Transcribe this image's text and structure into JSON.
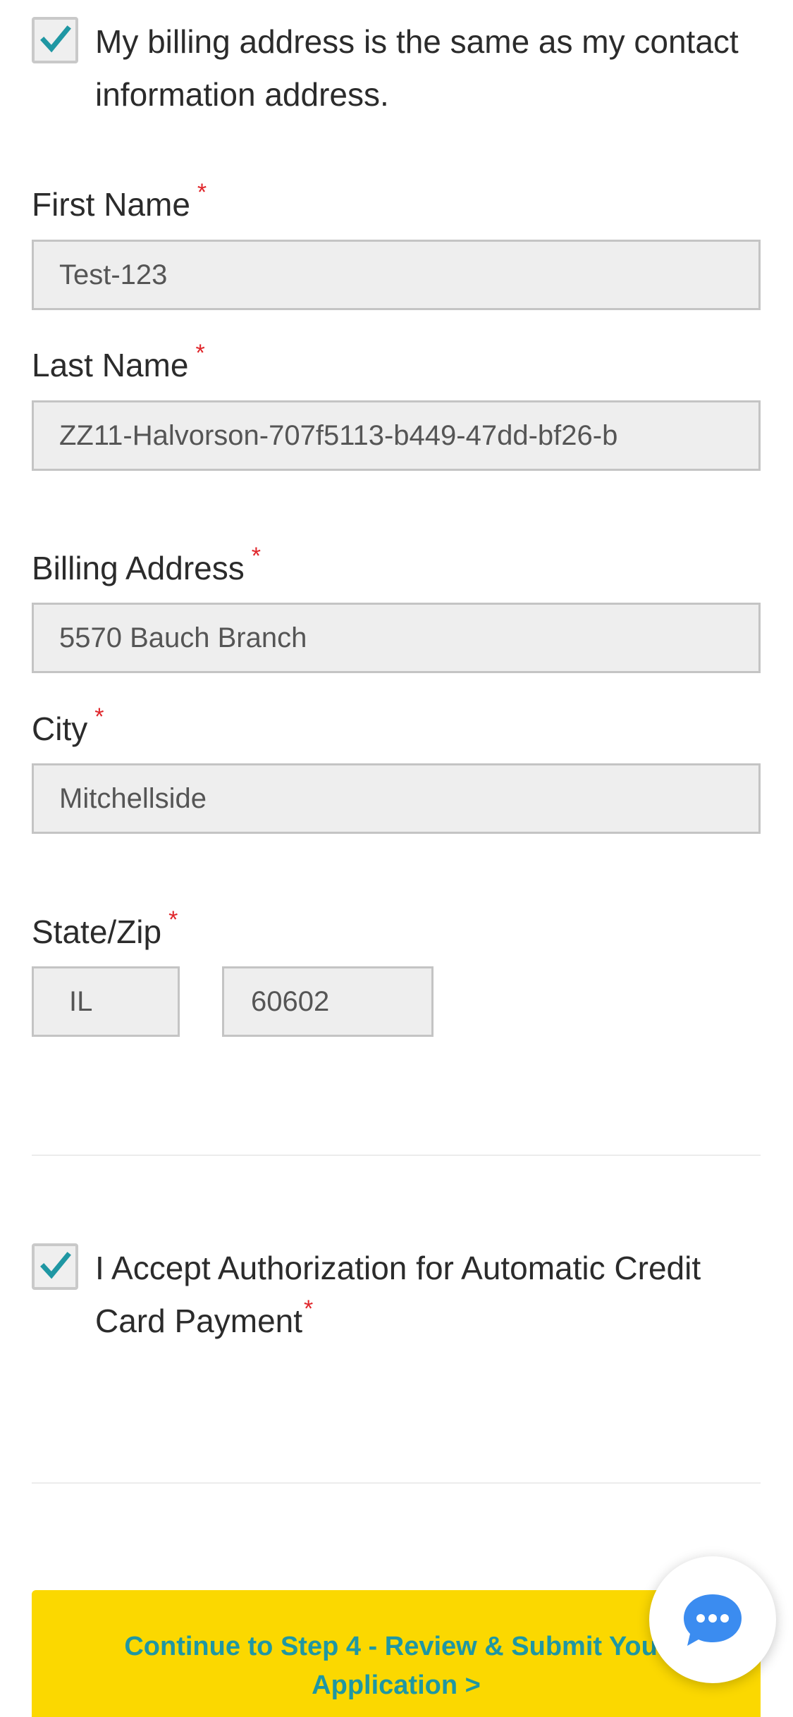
{
  "billing_same": {
    "checked": true,
    "label": "My billing address is the same as my contact information address."
  },
  "required_marker": "*",
  "fields": {
    "first_name": {
      "label": "First Name",
      "value": "Test-123"
    },
    "last_name": {
      "label": "Last Name",
      "value": "ZZ11-Halvorson-707f5113-b449-47dd-bf26-b"
    },
    "billing_address": {
      "label": "Billing Address",
      "value": "5570 Bauch Branch"
    },
    "city": {
      "label": "City",
      "value": "Mitchellside"
    },
    "state_zip": {
      "label": "State/Zip",
      "state": "IL",
      "zip": "60602"
    }
  },
  "authorization": {
    "checked": true,
    "label": "I Accept Authorization for Automatic Credit Card Payment"
  },
  "submit": {
    "label": "Continue to Step 4 - Review & Submit Your Application >"
  },
  "chat": {
    "icon": "chat-bubble-icon"
  },
  "colors": {
    "accent_teal": "#1f97a3",
    "button_yellow": "#fbd800",
    "required_red": "#e0262b",
    "chat_blue": "#3b8cf0"
  }
}
